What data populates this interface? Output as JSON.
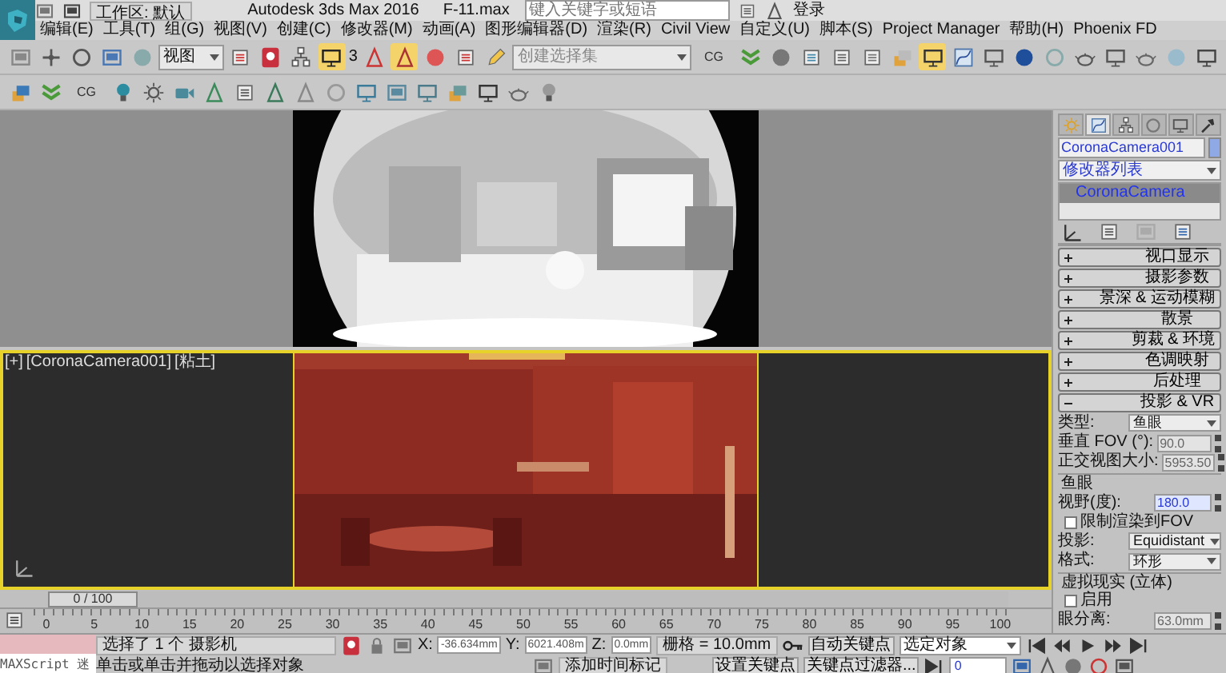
{
  "title_bar": {
    "workspace": "工作区: 默认",
    "app_title": "Autodesk 3ds Max 2016",
    "file_name": "F-11.max",
    "search": {
      "placeholder": "键入关键字或短语"
    },
    "sign_in": "登录"
  },
  "menu": [
    "编辑(E)",
    "工具(T)",
    "组(G)",
    "视图(V)",
    "创建(C)",
    "修改器(M)",
    "动画(A)",
    "图形编辑器(D)",
    "渲染(R)",
    "Civil View",
    "自定义(U)",
    "脚本(S)",
    "Project Manager",
    "帮助(H)",
    "Phoenix FD"
  ],
  "main_toolbar": {
    "view_dropdown": "视图",
    "snap_label": "3",
    "selection_set": {
      "placeholder": "创建选择集"
    },
    "label": "CG"
  },
  "secondary_toolbar": {
    "label": "CG"
  },
  "viewports": [
    {
      "active": false,
      "kind": "picture"
    },
    {
      "active": true,
      "labels": [
        "[+]",
        "[CoronaCamera001]",
        "[粘土]"
      ],
      "kind": "picture"
    }
  ],
  "command_panel": {
    "tabs": [
      {
        "selected": false
      },
      {
        "selected": true
      },
      {
        "selected": false
      },
      {
        "selected": false
      },
      {
        "selected": false
      },
      {
        "selected": false
      }
    ],
    "object_name": "CoronaCamera001",
    "modifier_list": "修改器列表",
    "stack": [
      {
        "label": "CoronaCamera",
        "selected": true
      }
    ],
    "rollouts": [
      {
        "title": "视口显示",
        "expanded": false
      },
      {
        "title": "摄影参数",
        "expanded": false
      },
      {
        "title": "景深 & 运动模糊",
        "expanded": false
      },
      {
        "title": "散景",
        "expanded": false
      },
      {
        "title": "剪裁 & 环境",
        "expanded": false
      },
      {
        "title": "色调映射",
        "expanded": false
      },
      {
        "title": "后处理",
        "expanded": false
      },
      {
        "title": "投影 & VR",
        "expanded": true
      }
    ],
    "params": [
      {
        "kind": "dropdown",
        "label": "类型:",
        "value": "鱼眼"
      },
      {
        "kind": "spinner",
        "label": "垂直 FOV (°):",
        "value": "90.0",
        "disabled": true,
        "focused": false
      },
      {
        "kind": "spinner",
        "label": "正交视图大小:",
        "value": "5953.50",
        "disabled": true,
        "focused": false
      },
      {
        "kind": "group",
        "label": "鱼眼"
      },
      {
        "kind": "spinner",
        "label": "视野(度):",
        "value": "180.0",
        "disabled": false,
        "focused": true
      },
      {
        "kind": "checkbox",
        "label": "限制渲染到FOV",
        "checked": false
      },
      {
        "kind": "dropdown",
        "label": "投影:",
        "value": "Equidistant"
      },
      {
        "kind": "dropdown",
        "label": "格式:",
        "value": "环形"
      },
      {
        "kind": "group",
        "label": "虚拟现实 (立体)"
      },
      {
        "kind": "checkbox",
        "label": "启用",
        "checked": false
      },
      {
        "kind": "spinner",
        "label": "眼分离:",
        "value": "63.0mm",
        "disabled": true,
        "focused": false
      }
    ]
  },
  "timeline": {
    "slider": "0 / 100",
    "level": 0,
    "ticks": [
      "0",
      "5",
      "10",
      "15",
      "20",
      "25",
      "30",
      "35",
      "40",
      "45",
      "50",
      "55",
      "60",
      "65",
      "70",
      "75",
      "80",
      "85",
      "90",
      "95",
      "100"
    ]
  },
  "status_bar": {
    "maxscript": "MAXScript 迷",
    "selection": "选择了 1 个 摄影机",
    "prompt": "单击或单击并拖动以选择对象",
    "coords": [
      {
        "label": "X:",
        "value": "-36.634mm"
      },
      {
        "label": "Y:",
        "value": "6021.408m"
      },
      {
        "label": "Z:",
        "value": "0.0mm"
      }
    ],
    "grid": "栅格 = 10.0mm",
    "add_time_tag": "添加时间标记",
    "auto_key": "自动关键点",
    "set_key": "设置关键点",
    "key_mode": "选定对象",
    "key_filters": "关键点过滤器...",
    "frame": "0"
  }
}
